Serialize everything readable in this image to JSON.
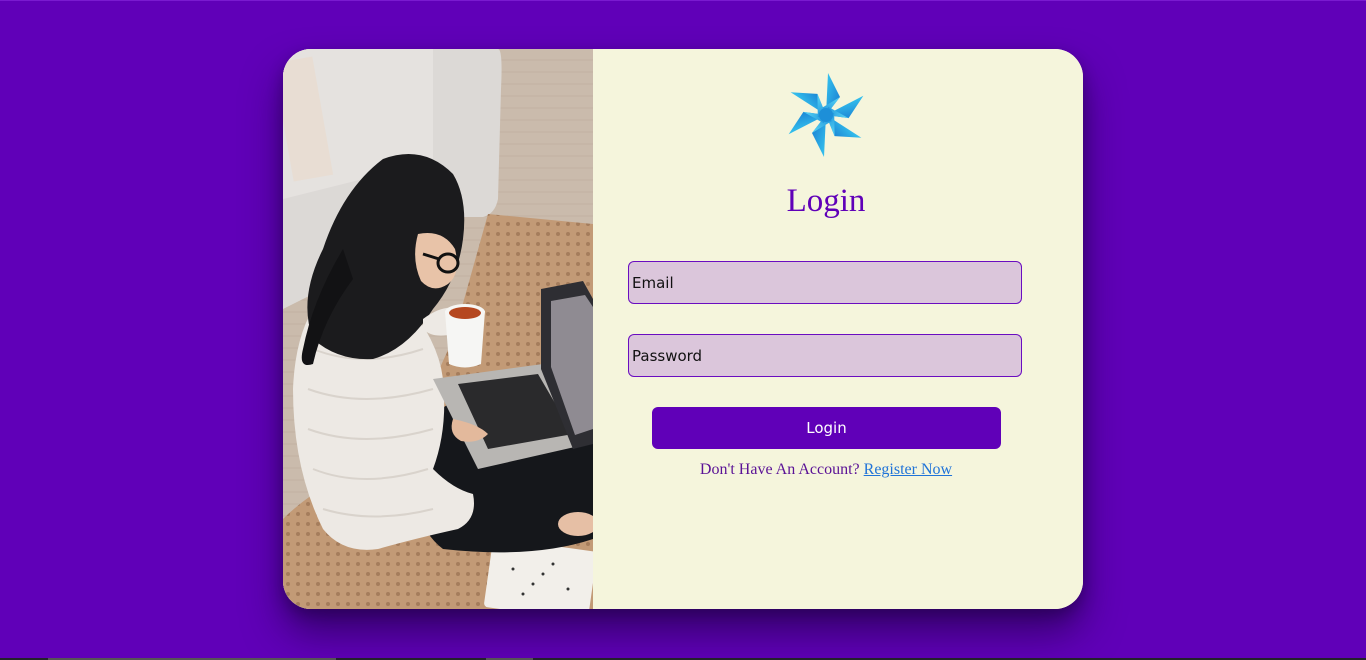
{
  "page": {
    "background_color": "#6000b8",
    "card_color": "#f5f5dc",
    "accent_color": "#6000b8"
  },
  "logo": {
    "icon": "pinwheel-logo-icon"
  },
  "photo": {
    "description_icon": "woman-with-laptop-photo"
  },
  "form": {
    "title": "Login",
    "email_placeholder": "Email",
    "password_placeholder": "Password",
    "login_label": "Login",
    "register_prompt": "Don't Have An Account?",
    "register_link": "Register Now"
  }
}
